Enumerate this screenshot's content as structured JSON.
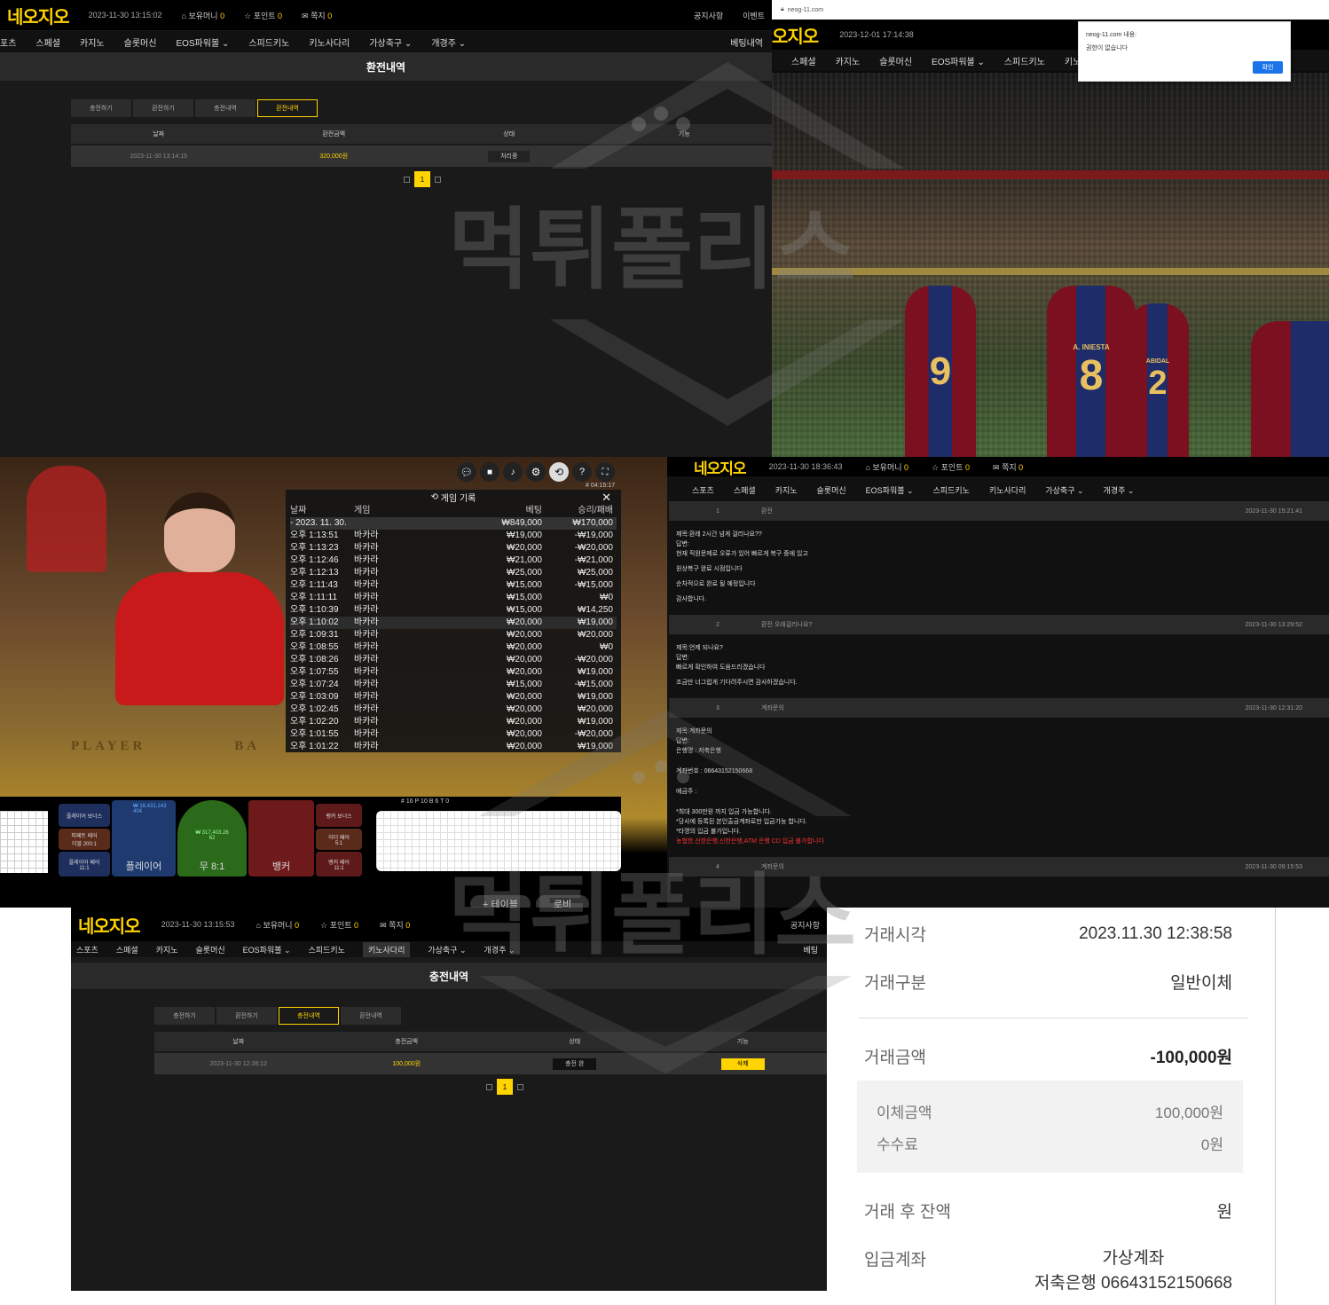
{
  "panel1": {
    "logo": "네오지오",
    "datetime": "2023-11-30 13:15:02",
    "money_label": "보유머니",
    "money_value": "0",
    "point_label": "포인트",
    "point_value": "0",
    "msg_label": "쪽지",
    "msg_value": "0",
    "notice": "공지사항",
    "event": "이벤트",
    "nav": [
      "포츠",
      "스페셜",
      "카지노",
      "슬롯머신",
      "EOS파워볼",
      "스피드키노",
      "키노사다리",
      "가상축구",
      "개경주"
    ],
    "nav_right": "베팅내역",
    "page_title": "환전내역",
    "tabs": [
      "충전하기",
      "환전하기",
      "충전내역",
      "환전내역"
    ],
    "active_tab": 3,
    "columns": [
      "날짜",
      "환전금액",
      "상태",
      "기능"
    ],
    "row": {
      "date": "2023-11-30 13:14:15",
      "amount": "320,000원",
      "status": "처리중"
    },
    "page": "1"
  },
  "panel2": {
    "url": "neog-11.com",
    "logo": "오지오",
    "datetime": "2023-12-01 17:14:38",
    "nav": [
      "스페셜",
      "카지노",
      "슬롯머신",
      "EOS파워볼",
      "스피드키노",
      "키노사다리"
    ],
    "dialog_title": "neog-11.com 내용:",
    "dialog_msg": "권한이 없습니다",
    "dialog_ok": "확인",
    "players": [
      "9",
      "8",
      "2"
    ],
    "jersey_names": [
      "A. INIESTA",
      "ABIDAL"
    ]
  },
  "panel3": {
    "history_title": "게임 기록",
    "timer": "# 04:15:17",
    "columns": [
      "날짜",
      "게임",
      "베팅",
      "승리/패배"
    ],
    "date_row": {
      "date": "- 2023. 11. 30.",
      "bet": "₩849,000",
      "result": "₩170,000"
    },
    "rows": [
      {
        "t": "오후 1:13:51",
        "g": "바카라",
        "b": "₩19,000",
        "r": "-₩19,000"
      },
      {
        "t": "오후 1:13:23",
        "g": "바카라",
        "b": "₩20,000",
        "r": "-₩20,000"
      },
      {
        "t": "오후 1:12:46",
        "g": "바카라",
        "b": "₩21,000",
        "r": "-₩21,000"
      },
      {
        "t": "오후 1:12:13",
        "g": "바카라",
        "b": "₩25,000",
        "r": "₩25,000"
      },
      {
        "t": "오후 1:11:43",
        "g": "바카라",
        "b": "₩15,000",
        "r": "-₩15,000"
      },
      {
        "t": "오후 1:11:11",
        "g": "바카라",
        "b": "₩15,000",
        "r": "₩0"
      },
      {
        "t": "오후 1:10:39",
        "g": "바카라",
        "b": "₩15,000",
        "r": "₩14,250"
      },
      {
        "t": "오후 1:10:02",
        "g": "바카라",
        "b": "₩20,000",
        "r": "₩19,000"
      },
      {
        "t": "오후 1:09:31",
        "g": "바카라",
        "b": "₩20,000",
        "r": "₩20,000"
      },
      {
        "t": "오후 1:08:55",
        "g": "바카라",
        "b": "₩20,000",
        "r": "₩0"
      },
      {
        "t": "오후 1:08:26",
        "g": "바카라",
        "b": "₩20,000",
        "r": "-₩20,000"
      },
      {
        "t": "오후 1:07:55",
        "g": "바카라",
        "b": "₩20,000",
        "r": "₩19,000"
      },
      {
        "t": "오후 1:07:24",
        "g": "바카라",
        "b": "₩15,000",
        "r": "-₩15,000"
      },
      {
        "t": "오후 1:03:09",
        "g": "바카라",
        "b": "₩20,000",
        "r": "₩19,000"
      },
      {
        "t": "오후 1:02:45",
        "g": "바카라",
        "b": "₩20,000",
        "r": "₩20,000"
      },
      {
        "t": "오후 1:02:20",
        "g": "바카라",
        "b": "₩20,000",
        "r": "₩19,000"
      },
      {
        "t": "오후 1:01:55",
        "g": "바카라",
        "b": "₩20,000",
        "r": "-₩20,000"
      },
      {
        "t": "오후 1:01:22",
        "g": "바카라",
        "b": "₩20,000",
        "r": "₩19,000"
      }
    ],
    "table_text": {
      "player": "PLAYER",
      "banker": "BA"
    },
    "bet_player_bonus": "플레이어 보너스",
    "bet_player_pair": "피페트 페어",
    "bet_player_pair_odds": "더블 200:1",
    "bet_player_pair2": "플레이어 페어",
    "bet_player_pair2_odds": "11:1",
    "bet_player": "플레이어",
    "bet_player_amt": "₩ 18,431,143",
    "bet_player_cnt": "404",
    "bet_tie": "무 8:1",
    "bet_tie_amt": "₩ 317,403.26",
    "bet_tie_cnt": "62",
    "bet_banker": "뱅커",
    "bet_banker_bonus": "뱅커 보너스",
    "bet_either_pair": "이더 페어",
    "bet_either_odds": "5:1",
    "bet_banker_pair": "뱅커 페어",
    "bet_banker_pair_odds": "11:1",
    "road_stats": "# 16  P 10  B 6  T 0",
    "lobby": "로비",
    "table_btn": "+ 테이블"
  },
  "panel4": {
    "logo": "네오지오",
    "datetime": "2023-11-30 18:36:43",
    "money_label": "보유머니",
    "money_value": "0",
    "point_label": "포인트",
    "point_value": "0",
    "msg_label": "쪽지",
    "msg_value": "0",
    "nav": [
      "스포츠",
      "스페셜",
      "카지노",
      "슬롯머신",
      "EOS파워볼",
      "스피드키노",
      "키노사다리",
      "가상축구",
      "개경주"
    ],
    "items": [
      {
        "no": "1",
        "title": "환전",
        "date": "2023-11-30 15:21:41",
        "lines": [
          "제목:환레 2시간 넘게 걸리나요??",
          "답변:",
          "현재 직원문제로 오류가 있어 빠르게 복구 중에 있고",
          "",
          "원상복구 완료 시점입니다",
          "",
          "순차적으로 완료 될 예정입니다",
          "",
          "감사합니다."
        ]
      },
      {
        "no": "2",
        "title": "환전 오래걸리나요?",
        "date": "2023-11-30 13:29:52",
        "lines": [
          "제목:언제 되나요?",
          "답변:",
          "빠르게 확인하여 도움드리겠습니다",
          "",
          "조금만 너그럽게 기다려주시면 감사하겠습니다."
        ]
      },
      {
        "no": "3",
        "title": "계좌문의",
        "date": "2023-11-30 12:31:20",
        "lines": [
          "제목:계좌문의",
          "답변:",
          "은행명 : 저축은행",
          "",
          "",
          "계좌번호 : 06643152150668",
          "",
          "",
          "예금주 :",
          "",
          "",
          "*최대 300만원 까지 입금 가능합니다.",
          "*당사에 등록된 본인출금계좌로만 입금가능 합니다.",
          "*타명의 입금 불가입니다."
        ],
        "warn": "농협한,신한은행,신한은행,ATM 은행 CD 입금 불가합니다"
      },
      {
        "no": "4",
        "title": "계좌문의",
        "date": "2023-11-30 09:15:53",
        "lines": []
      }
    ]
  },
  "panel5": {
    "logo": "네오지오",
    "datetime": "2023-11-30 13:15:53",
    "money_label": "보유머니",
    "money_value": "0",
    "point_label": "포인트",
    "point_value": "0",
    "msg_label": "쪽지",
    "msg_value": "0",
    "notice": "공지사항",
    "nav": [
      "스포츠",
      "스페셜",
      "카지노",
      "슬롯머신",
      "EOS파워볼",
      "스피드키노",
      "키노사다리",
      "가상축구",
      "개경주"
    ],
    "nav_right": "베팅",
    "page_title": "충전내역",
    "tabs": [
      "충전하기",
      "환전하기",
      "충전내역",
      "환전내역"
    ],
    "active_tab": 2,
    "columns": [
      "날짜",
      "충전금액",
      "상태",
      "기능"
    ],
    "row": {
      "date": "2023-11-30 12:38:12",
      "amount": "100,000원",
      "status": "충전 완",
      "action": "삭제"
    },
    "page": "1"
  },
  "receipt": {
    "time_label": "거래시각",
    "time_value": "2023.11.30 12:38:58",
    "type_label": "거래구분",
    "type_value": "일반이체",
    "amount_label": "거래금액",
    "amount_value": "-100,000원",
    "transfer_label": "이체금액",
    "transfer_value": "100,000원",
    "fee_label": "수수료",
    "fee_value": "0원",
    "balance_label": "거래 후 잔액",
    "balance_value": "원",
    "account_label": "입금계좌",
    "account_type": "가상계좌",
    "account_value": "저축은행 06643152150668"
  },
  "watermark": "먹튀폴리스",
  "colors": {
    "brand": "#ffd400",
    "bg": "#1a1a1a",
    "bar": "#2a2a2a"
  }
}
